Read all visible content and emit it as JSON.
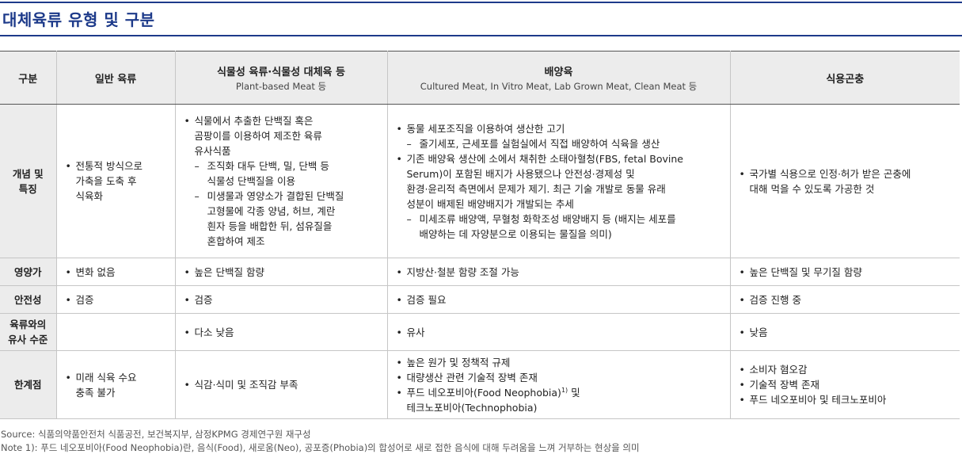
{
  "title": "대체육류 유형 및 구분",
  "table": {
    "headers": {
      "col0": "구분",
      "col1": "일반 육류",
      "col2_main": "식물성 육류·식물성 대체육 등",
      "col2_sub": "Plant-based Meat 등",
      "col3_main": "배양육",
      "col3_sub": "Cultured Meat, In Vitro Meat, Lab Grown Meat, Clean Meat 등",
      "col4": "식용곤충"
    },
    "rows": {
      "concept": {
        "label": "개념 및\n특징",
        "general": "전통적 방식으로\n가축을 도축 후\n식육화",
        "plant_1": "식물에서 추출한 단백질 혹은\n곰팡이를 이용하여 제조한 육류\n유사식품",
        "plant_1_sub1": "조직화 대두 단백, 밀, 단백 등\n식물성 단백질을 이용",
        "plant_1_sub2": "미생물과 영양소가 결합된 단백질\n고형물에 각종 양념, 허브, 계란\n흰자 등을 배합한 뒤, 섬유질을\n혼합하여 제조",
        "cultured_1": "동물 세포조직을 이용하여 생산한 고기",
        "cultured_1_sub1": "줄기세포, 근세포를 실험실에서 직접 배양하여 식육을 생산",
        "cultured_2": "기존 배양육 생산에 소에서 채취한 소태아혈청(FBS, fetal Bovine\nSerum)이 포함된 배지가 사용됐으나 안전성·경제성 및\n환경·윤리적 측면에서 문제가 제기. 최근 기술 개발로 동물 유래\n성분이 배제된 배양배지가 개발되는 추세",
        "cultured_2_sub1": "미세조류 배양액, 무혈청 화학조성 배양배지 등 (배지는 세포를\n배양하는 데 자양분으로 이용되는 물질을 의미)",
        "insect": "국가별 식용으로 인정·허가 받은 곤충에\n대해 먹을 수 있도록 가공한 것"
      },
      "nutrition": {
        "label": "영양가",
        "general": "변화 없음",
        "plant": "높은 단백질 함량",
        "cultured": "지방산·철분 함량 조절 가능",
        "insect": "높은 단백질 및 무기질 함량"
      },
      "safety": {
        "label": "안전성",
        "general": "검증",
        "plant": "검증",
        "cultured": "검증 필요",
        "insect": "검증 진행 중"
      },
      "similarity": {
        "label": "육류와의\n유사 수준",
        "general": "",
        "plant": "다소 낮음",
        "cultured": "유사",
        "insect": "낮음"
      },
      "limits": {
        "label": "한계점",
        "general": "미래 식육 수요\n충족 불가",
        "plant": "식감·식미 및 조직감 부족",
        "cultured_1": "높은 원가 및 정책적 규제",
        "cultured_2": "대량생산 관련 기술적 장벽 존재",
        "cultured_3a": "푸드 네오포비아(Food Neophobia)",
        "cultured_3_sup": "1)",
        "cultured_3b": " 및\n테크노포비아(Technophobia)",
        "insect_1": "소비자 혐오감",
        "insect_2": "기술적 장벽 존재",
        "insect_3": "푸드 네오포비아 및 테크노포비아"
      }
    }
  },
  "source": "Source: 식품의약품안전처 식품공전, 보건복지부, 삼정KPMG 경제연구원 재구성",
  "note": "Note 1): 푸드 네오포비아(Food Neophobia)란, 음식(Food), 새로움(Neo), 공포증(Phobia)의 합성어로 새로 접한 음식에 대해 두려움을 느껴 거부하는 현상을 의미"
}
